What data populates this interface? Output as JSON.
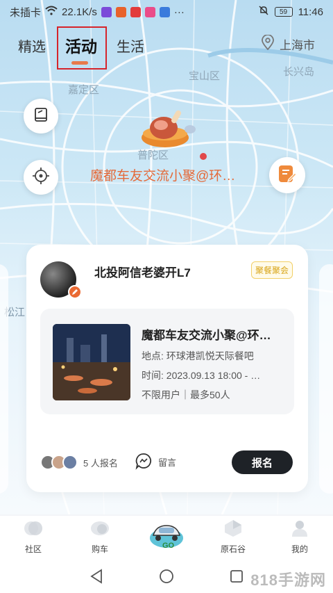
{
  "status_bar": {
    "sim": "未插卡",
    "speed": "22.1K/s",
    "battery": "59",
    "time": "11:46"
  },
  "tabs": [
    {
      "label": "精选",
      "active": false
    },
    {
      "label": "活动",
      "active": true
    },
    {
      "label": "生活",
      "active": false
    }
  ],
  "location": {
    "city": "上海市",
    "icon": "location-pin-icon"
  },
  "map": {
    "labels": [
      "宝山区",
      "长兴岛",
      "嘉定区",
      "普陀区",
      "松江"
    ],
    "pin_title": "魔都车友交流小聚@环…"
  },
  "card": {
    "username": "北投阿信老婆开L7",
    "tag": "聚餐聚会",
    "event": {
      "title": "魔都车友交流小聚@环…",
      "location": "地点: 环球港凯悦天际餐吧",
      "time": "时间: 2023.09.13 18:00 - …",
      "limits": "不限用户｜最多50人"
    },
    "signup_count": "5",
    "signup_label": "人报名",
    "comment_label": "留言",
    "join_label": "报名"
  },
  "bottom_nav": [
    {
      "label": "社区"
    },
    {
      "label": "购车"
    },
    {
      "label": "",
      "icon": "car-go-icon"
    },
    {
      "label": "原石谷"
    },
    {
      "label": "我的"
    }
  ],
  "watermark": "818手游网",
  "colors": {
    "accent": "#e46a3a",
    "tag": "#d9a61a",
    "button": "#1e2227"
  }
}
